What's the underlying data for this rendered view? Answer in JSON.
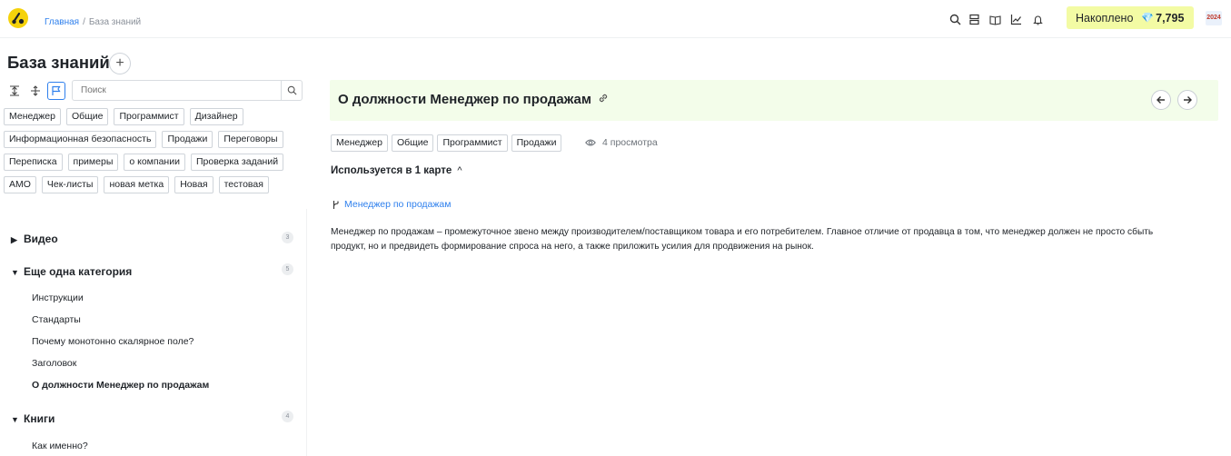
{
  "colors": {
    "accent": "#2f80ed",
    "logo": "#f5d20b",
    "accumulated_bg": "#f3fba4",
    "doc_header_bg": "#f3fdea"
  },
  "breadcrumb": {
    "home": "Главная",
    "separator": "/",
    "current": "База знаний"
  },
  "topbar": {
    "icons": [
      "search-icon",
      "server-icon",
      "book-icon",
      "chart-icon",
      "bell-icon"
    ],
    "accumulated_label": "Накоплено",
    "accumulated_gem": "💎",
    "accumulated_value": "7,795",
    "avatar_text": "2024"
  },
  "sidebar": {
    "title": "База знаний",
    "add_label": "+",
    "search_placeholder": "Поиск",
    "tags": [
      "Менеджер",
      "Общие",
      "Программист",
      "Дизайнер",
      "Информационная безопасность",
      "Продажи",
      "Переговоры",
      "Переписка",
      "примеры",
      "о компании",
      "Проверка заданий",
      "АМО",
      "Чек-листы",
      "новая метка",
      "Новая",
      "тестовая"
    ],
    "categories": [
      {
        "arrow": "▶",
        "label": "Видео",
        "count": "3"
      },
      {
        "arrow": "▼",
        "label": "Еще одна категория",
        "count": "5"
      },
      {
        "arrow": "▼",
        "label": "Книги",
        "count": "4"
      }
    ],
    "items_cat2": [
      "Инструкции",
      "Стандарты",
      "Почему монотонно скалярное поле?",
      "Заголовок",
      "О должности Менеджер по продажам"
    ],
    "items_cat3": [
      "Как именно?"
    ]
  },
  "doc": {
    "title": "О должности Менеджер по продажам",
    "tags": [
      "Менеджер",
      "Общие",
      "Программист",
      "Продажи"
    ],
    "views": "4 просмотра",
    "used_in": "Используется в 1 карте",
    "map_link": "Менеджер по продажам",
    "body_line1": "Менеджер по продажам – промежуточное звено между производителем/поставщиком товара и его потребителем. Главное отличие от продавца в том, что менеджер должен не просто сбыть",
    "body_line2": "продукт, но и предвидеть формирование спроса на него, а также приложить усилия для продвижения на рынок."
  }
}
